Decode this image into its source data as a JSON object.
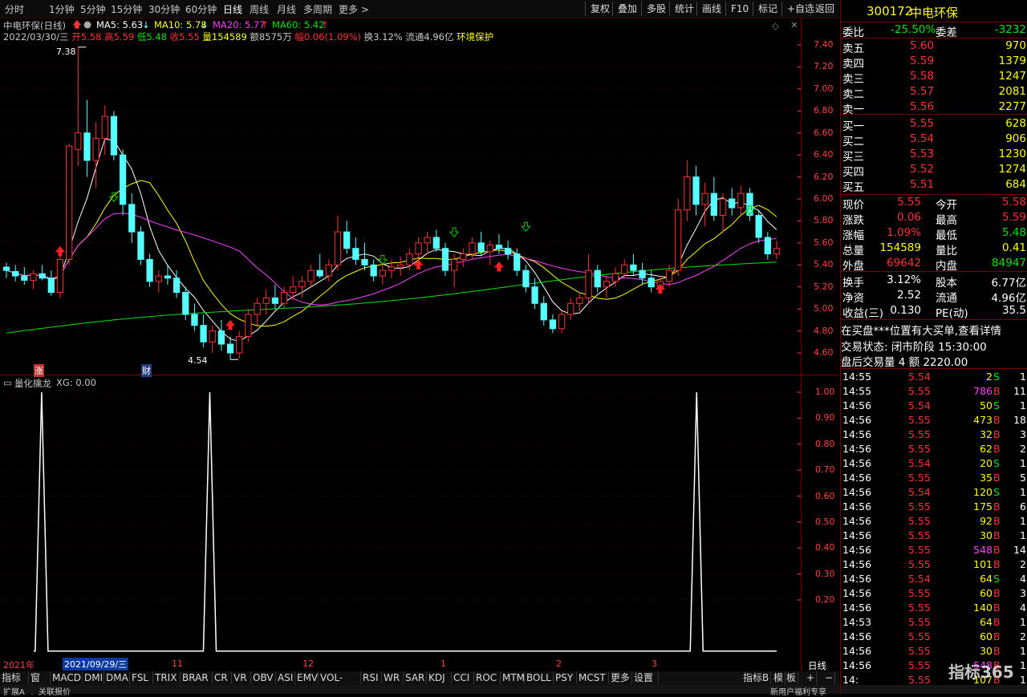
{
  "toolbar": {
    "left": [
      "分时",
      "1分钟",
      "5分钟",
      "15分钟",
      "30分钟",
      "60分钟",
      "日线",
      "周线",
      "月线",
      "多周期",
      "更多 >"
    ],
    "active": "日线",
    "right": [
      "复权",
      "叠加",
      "多股",
      "统计",
      "画线",
      "F10",
      "标记",
      "+自选",
      "返回"
    ]
  },
  "chart_header": {
    "name": "中电环保(日线)",
    "ma5": "MA5: 5.63",
    "ma10": "MA10: 5.78",
    "ma20": "MA20: 5.77",
    "ma60": "MA60: 5.42",
    "date": "2022/03/30/三",
    "open_label": "开",
    "open": "5.58",
    "high_label": "高",
    "high": "5.59",
    "low_label": "低",
    "low": "5.48",
    "close_label": "收",
    "close": "5.55",
    "vol_label": "量",
    "vol": "154589",
    "amt_label": "额",
    "amt": "8575万",
    "chg_label": "幅",
    "chg": "0.06(1.09%)",
    "turnover": "换3.12%",
    "float": "流通4.96亿",
    "sector": "环境保护"
  },
  "price_axis": [
    "7.40",
    "7.20",
    "7.00",
    "6.80",
    "6.60",
    "6.40",
    "6.20",
    "6.00",
    "5.80",
    "5.60",
    "5.40",
    "5.20",
    "5.00",
    "4.80",
    "4.60"
  ],
  "price_markers": {
    "high": "7.38",
    "low": "4.54",
    "tag1": "涨",
    "tag2": "财"
  },
  "indicator": {
    "title": "量化擒龙",
    "value": "XG: 0.00",
    "axis": [
      "1.00",
      "0.90",
      "0.80",
      "0.70",
      "0.60",
      "0.50",
      "0.40",
      "0.30",
      "0.20"
    ]
  },
  "date_axis": {
    "labels": [
      "2021年",
      "2021/09/29/三",
      "11",
      "12",
      "1",
      "2",
      "3"
    ],
    "mode": "日线"
  },
  "bottom_tabs": [
    "指标A",
    "窗口",
    "MACD",
    "DMI",
    "DMA",
    "FSL",
    "TRIX",
    "BRAR",
    "CR",
    "VR",
    "OBV",
    "ASI",
    "EMV",
    "VOL-TDX",
    "RSI",
    "WR",
    "SAR",
    "KDJ",
    "CCI",
    "ROC",
    "MTM",
    "BOLL",
    "PSY",
    "MCST",
    "更多",
    "设置"
  ],
  "bottom_right": [
    "指标B",
    "模",
    "板",
    "+",
    "−"
  ],
  "status_bar": {
    "left1": "扩展A",
    "left2": "关联报价",
    "right": "新用户福利专享"
  },
  "quote": {
    "code": "300172",
    "name": "中电环保",
    "weibi_label": "委比",
    "weibi": "-25.50%",
    "weicha_label": "委差",
    "weicha": "-3232",
    "asks": [
      {
        "label": "卖五",
        "price": "5.60",
        "vol": "970"
      },
      {
        "label": "卖四",
        "price": "5.59",
        "vol": "1379"
      },
      {
        "label": "卖三",
        "price": "5.58",
        "vol": "1247"
      },
      {
        "label": "卖二",
        "price": "5.57",
        "vol": "2081"
      },
      {
        "label": "卖一",
        "price": "5.56",
        "vol": "2277"
      }
    ],
    "bids": [
      {
        "label": "买一",
        "price": "5.55",
        "vol": "628"
      },
      {
        "label": "买二",
        "price": "5.54",
        "vol": "906"
      },
      {
        "label": "买三",
        "price": "5.53",
        "vol": "1230"
      },
      {
        "label": "买四",
        "price": "5.52",
        "vol": "1274"
      },
      {
        "label": "买五",
        "price": "5.51",
        "vol": "684"
      }
    ],
    "stats": [
      {
        "l1": "现价",
        "v1": "5.55",
        "l2": "今开",
        "v2": "5.58",
        "c1": "red",
        "c2": "red"
      },
      {
        "l1": "涨跌",
        "v1": "0.06",
        "l2": "最高",
        "v2": "5.59",
        "c1": "red",
        "c2": "red"
      },
      {
        "l1": "涨幅",
        "v1": "1.09%",
        "l2": "最低",
        "v2": "5.48",
        "c1": "red",
        "c2": "green"
      },
      {
        "l1": "总量",
        "v1": "154589",
        "l2": "量比",
        "v2": "0.41",
        "c1": "yellow",
        "c2": "yellow"
      },
      {
        "l1": "外盘",
        "v1": "69642",
        "l2": "内盘",
        "v2": "84947",
        "c1": "red",
        "c2": "green"
      }
    ],
    "stats2": [
      {
        "l1": "换手",
        "v1": "3.12%",
        "l2": "股本",
        "v2": "6.77亿"
      },
      {
        "l1": "净资",
        "v1": "2.52",
        "l2": "流通",
        "v2": "4.96亿"
      },
      {
        "l1": "收益(三)",
        "v1": "0.130",
        "l2": "PE(动)",
        "v2": "35.5"
      }
    ],
    "notice": "在买盘***位置有大买单,查看详情",
    "trade_status": "交易状态: 闭市阶段 15:30:00",
    "after_hours": "盘后交易量 4 额 2220.00"
  },
  "ticks": [
    {
      "t": "14:55",
      "p": "5.54",
      "v": "2",
      "s": "S",
      "n": "1",
      "pc": "red",
      "vc": "yellow",
      "sc": "green"
    },
    {
      "t": "14:55",
      "p": "5.55",
      "v": "786",
      "s": "B",
      "n": "11",
      "pc": "red",
      "vc": "mag",
      "sc": "red"
    },
    {
      "t": "14:56",
      "p": "5.54",
      "v": "50",
      "s": "S",
      "n": "1",
      "pc": "red",
      "vc": "yellow",
      "sc": "green"
    },
    {
      "t": "14:56",
      "p": "5.55",
      "v": "473",
      "s": "B",
      "n": "18",
      "pc": "red",
      "vc": "yellow",
      "sc": "red"
    },
    {
      "t": "14:56",
      "p": "5.55",
      "v": "32",
      "s": "B",
      "n": "3",
      "pc": "red",
      "vc": "yellow",
      "sc": "red"
    },
    {
      "t": "14:56",
      "p": "5.55",
      "v": "62",
      "s": "B",
      "n": "2",
      "pc": "red",
      "vc": "yellow",
      "sc": "red"
    },
    {
      "t": "14:56",
      "p": "5.54",
      "v": "20",
      "s": "S",
      "n": "1",
      "pc": "red",
      "vc": "yellow",
      "sc": "green"
    },
    {
      "t": "14:56",
      "p": "5.55",
      "v": "35",
      "s": "B",
      "n": "5",
      "pc": "red",
      "vc": "yellow",
      "sc": "red"
    },
    {
      "t": "14:56",
      "p": "5.54",
      "v": "120",
      "s": "S",
      "n": "1",
      "pc": "red",
      "vc": "yellow",
      "sc": "green"
    },
    {
      "t": "14:56",
      "p": "5.55",
      "v": "175",
      "s": "B",
      "n": "6",
      "pc": "red",
      "vc": "yellow",
      "sc": "red"
    },
    {
      "t": "14:56",
      "p": "5.55",
      "v": "92",
      "s": "B",
      "n": "1",
      "pc": "red",
      "vc": "yellow",
      "sc": "red"
    },
    {
      "t": "14:56",
      "p": "5.55",
      "v": "30",
      "s": "B",
      "n": "1",
      "pc": "red",
      "vc": "yellow",
      "sc": "red"
    },
    {
      "t": "14:56",
      "p": "5.55",
      "v": "548",
      "s": "B",
      "n": "14",
      "pc": "red",
      "vc": "mag",
      "sc": "red"
    },
    {
      "t": "14:56",
      "p": "5.55",
      "v": "101",
      "s": "B",
      "n": "2",
      "pc": "red",
      "vc": "yellow",
      "sc": "red"
    },
    {
      "t": "14:56",
      "p": "5.54",
      "v": "64",
      "s": "S",
      "n": "4",
      "pc": "red",
      "vc": "yellow",
      "sc": "green"
    },
    {
      "t": "14:56",
      "p": "5.55",
      "v": "60",
      "s": "B",
      "n": "3",
      "pc": "red",
      "vc": "yellow",
      "sc": "red"
    },
    {
      "t": "14:56",
      "p": "5.55",
      "v": "140",
      "s": "B",
      "n": "4",
      "pc": "red",
      "vc": "yellow",
      "sc": "red"
    },
    {
      "t": "14:53",
      "p": "5.55",
      "v": "64",
      "s": "B",
      "n": "1",
      "pc": "red",
      "vc": "yellow",
      "sc": "red"
    },
    {
      "t": "14:56",
      "p": "5.55",
      "v": "60",
      "s": "B",
      "n": "2",
      "pc": "red",
      "vc": "yellow",
      "sc": "red"
    },
    {
      "t": "14:56",
      "p": "5.55",
      "v": "30",
      "s": "B",
      "n": "1",
      "pc": "red",
      "vc": "yellow",
      "sc": "red"
    },
    {
      "t": "14:56",
      "p": "5.55",
      "v": "548",
      "s": "B",
      "n": "1",
      "pc": "red",
      "vc": "mag",
      "sc": "red"
    },
    {
      "t": "14:",
      "p": "5.55",
      "v": "107",
      "s": "B",
      "n": "1",
      "pc": "red",
      "vc": "yellow",
      "sc": "red"
    }
  ],
  "watermark": "指标365",
  "chart_data": {
    "type": "candlestick",
    "ylim": [
      4.5,
      7.5
    ],
    "candles": [
      [
        5.38,
        5.42,
        5.28,
        5.35
      ],
      [
        5.34,
        5.4,
        5.25,
        5.3
      ],
      [
        5.3,
        5.38,
        5.22,
        5.26
      ],
      [
        5.26,
        5.35,
        5.18,
        5.32
      ],
      [
        5.32,
        5.4,
        5.26,
        5.28
      ],
      [
        5.28,
        5.35,
        5.12,
        5.15
      ],
      [
        5.15,
        5.48,
        5.1,
        5.45
      ],
      [
        5.45,
        6.5,
        5.4,
        6.48
      ],
      [
        6.45,
        7.38,
        6.3,
        6.6
      ],
      [
        6.6,
        6.9,
        6.2,
        6.35
      ],
      [
        6.35,
        6.7,
        6.1,
        6.55
      ],
      [
        6.55,
        6.85,
        6.4,
        6.75
      ],
      [
        6.75,
        6.8,
        6.35,
        6.4
      ],
      [
        6.4,
        6.45,
        5.85,
        5.95
      ],
      [
        5.95,
        6.05,
        5.6,
        5.7
      ],
      [
        5.7,
        5.75,
        5.4,
        5.45
      ],
      [
        5.45,
        5.5,
        5.2,
        5.25
      ],
      [
        5.25,
        5.35,
        5.15,
        5.3
      ],
      [
        5.3,
        5.4,
        5.22,
        5.28
      ],
      [
        5.28,
        5.35,
        5.1,
        5.15
      ],
      [
        5.15,
        5.2,
        4.9,
        4.95
      ],
      [
        4.95,
        5.05,
        4.8,
        4.85
      ],
      [
        4.85,
        4.95,
        4.65,
        4.7
      ],
      [
        4.7,
        4.85,
        4.6,
        4.8
      ],
      [
        4.8,
        4.9,
        4.62,
        4.68
      ],
      [
        4.68,
        4.75,
        4.54,
        4.6
      ],
      [
        4.6,
        4.8,
        4.55,
        4.75
      ],
      [
        4.75,
        5.0,
        4.7,
        4.95
      ],
      [
        4.95,
        5.1,
        4.85,
        5.05
      ],
      [
        5.05,
        5.18,
        4.95,
        5.1
      ],
      [
        5.1,
        5.22,
        5.0,
        5.05
      ],
      [
        5.05,
        5.2,
        5.0,
        5.15
      ],
      [
        5.15,
        5.3,
        5.08,
        5.2
      ],
      [
        5.2,
        5.3,
        5.1,
        5.25
      ],
      [
        5.25,
        5.4,
        5.2,
        5.35
      ],
      [
        5.35,
        5.5,
        5.28,
        5.3
      ],
      [
        5.3,
        5.45,
        5.25,
        5.4
      ],
      [
        5.4,
        5.85,
        5.35,
        5.7
      ],
      [
        5.7,
        5.8,
        5.5,
        5.55
      ],
      [
        5.55,
        5.65,
        5.4,
        5.45
      ],
      [
        5.45,
        5.6,
        5.35,
        5.4
      ],
      [
        5.4,
        5.45,
        5.25,
        5.3
      ],
      [
        5.3,
        5.4,
        5.22,
        5.35
      ],
      [
        5.35,
        5.45,
        5.28,
        5.38
      ],
      [
        5.38,
        5.48,
        5.3,
        5.4
      ],
      [
        5.4,
        5.55,
        5.35,
        5.5
      ],
      [
        5.5,
        5.65,
        5.45,
        5.6
      ],
      [
        5.6,
        5.7,
        5.5,
        5.65
      ],
      [
        5.65,
        5.72,
        5.52,
        5.55
      ],
      [
        5.55,
        5.6,
        5.3,
        5.35
      ],
      [
        5.35,
        5.5,
        5.2,
        5.45
      ],
      [
        5.45,
        5.55,
        5.38,
        5.5
      ],
      [
        5.5,
        5.65,
        5.45,
        5.6
      ],
      [
        5.6,
        5.7,
        5.48,
        5.52
      ],
      [
        5.52,
        5.62,
        5.4,
        5.58
      ],
      [
        5.58,
        5.68,
        5.5,
        5.55
      ],
      [
        5.55,
        5.62,
        5.45,
        5.5
      ],
      [
        5.5,
        5.55,
        5.3,
        5.35
      ],
      [
        5.35,
        5.4,
        5.15,
        5.2
      ],
      [
        5.2,
        5.28,
        5.0,
        5.05
      ],
      [
        5.05,
        5.12,
        4.85,
        4.9
      ],
      [
        4.9,
        4.95,
        4.78,
        4.82
      ],
      [
        4.82,
        4.98,
        4.78,
        4.95
      ],
      [
        4.95,
        5.1,
        4.9,
        5.05
      ],
      [
        5.05,
        5.15,
        4.98,
        5.1
      ],
      [
        5.1,
        5.5,
        5.05,
        5.35
      ],
      [
        5.35,
        5.4,
        5.15,
        5.2
      ],
      [
        5.2,
        5.3,
        5.1,
        5.25
      ],
      [
        5.25,
        5.38,
        5.2,
        5.32
      ],
      [
        5.32,
        5.45,
        5.28,
        5.4
      ],
      [
        5.4,
        5.5,
        5.3,
        5.35
      ],
      [
        5.35,
        5.42,
        5.22,
        5.28
      ],
      [
        5.28,
        5.35,
        5.15,
        5.2
      ],
      [
        5.2,
        5.3,
        5.15,
        5.25
      ],
      [
        5.25,
        5.4,
        5.2,
        5.35
      ],
      [
        5.35,
        6.0,
        5.3,
        5.9
      ],
      [
        5.9,
        6.35,
        5.8,
        6.2
      ],
      [
        6.2,
        6.3,
        5.85,
        5.95
      ],
      [
        5.95,
        6.15,
        5.75,
        6.05
      ],
      [
        6.05,
        6.2,
        5.8,
        5.85
      ],
      [
        5.85,
        6.05,
        5.7,
        6.0
      ],
      [
        6.0,
        6.1,
        5.85,
        5.92
      ],
      [
        5.92,
        6.12,
        5.85,
        6.05
      ],
      [
        6.05,
        6.1,
        5.8,
        5.85
      ],
      [
        5.85,
        5.9,
        5.6,
        5.65
      ],
      [
        5.65,
        5.7,
        5.45,
        5.5
      ],
      [
        5.5,
        5.62,
        5.45,
        5.55
      ]
    ],
    "xg_signal_positions": [
      0.052,
      0.262,
      0.87
    ]
  }
}
